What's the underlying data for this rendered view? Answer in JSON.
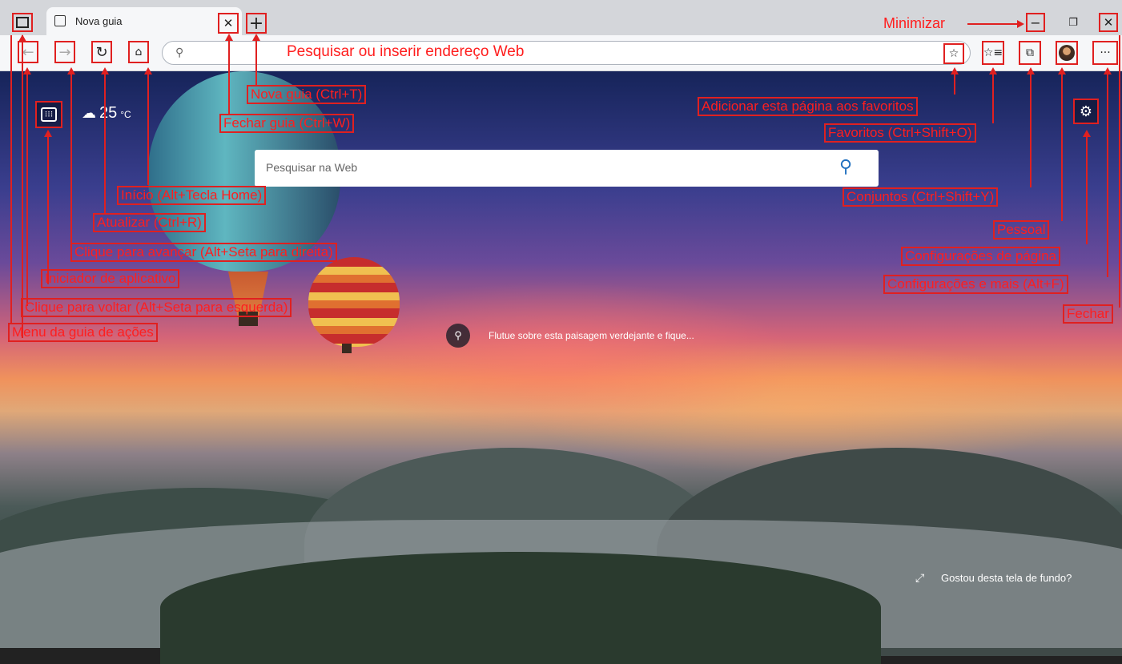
{
  "tab": {
    "title": "Nova guia",
    "close_glyph": "✕",
    "new_glyph": "+"
  },
  "address_bar": {
    "placeholder_annotation": "Pesquisar ou inserir endereço Web"
  },
  "window": {
    "minimize_label": "Minimizar",
    "minimize_glyph": "−",
    "restore_glyph": "❐",
    "close_glyph": "✕"
  },
  "toolbar": {
    "more_glyph": "···"
  },
  "weather": {
    "temperature": "25",
    "unit": "°C"
  },
  "search": {
    "placeholder": "Pesquisar na Web"
  },
  "caption": {
    "text": "Flutue sobre esta paisagem verdejante e fique..."
  },
  "footer": {
    "like_wallpaper": "Gostou desta tela de fundo?"
  },
  "annotations": {
    "nova_guia": "Nova guia (Ctrl+T)",
    "fechar_guia": "Fechar guia (Ctrl+W)",
    "inicio": "Início (Alt+Tecla Home)",
    "atualizar": "Atualizar (Ctrl+R)",
    "avancar": "Clique para avançar (Alt+Seta para direita)",
    "iniciador": "Iniciador de aplicativo",
    "voltar": "Clique para voltar (Alt+Seta para esquerda)",
    "menu_guia": "Menu da guia de ações",
    "adicionar_favoritos": "Adicionar esta página aos favoritos",
    "favoritos": "Favoritos (Ctrl+Shift+O)",
    "conjuntos": "Conjuntos (Ctrl+Shift+Y)",
    "pessoal": "Pessoal",
    "config_pagina": "Configurações de página",
    "config_mais": "Configurações e mais (Alt+F)",
    "fechar": "Fechar"
  },
  "colors": {
    "annotation": "#e02020",
    "toolbar_bg": "#f6f7f9",
    "titlebar_bg": "#d4d6da"
  }
}
